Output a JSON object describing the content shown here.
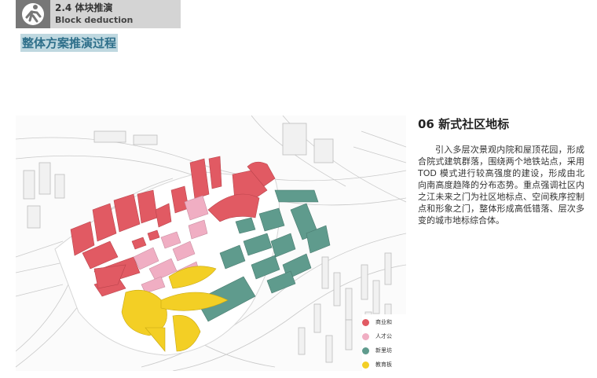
{
  "header": {
    "title": "2.4 体块推演",
    "subtitle": "Block deduction"
  },
  "page_title": "整体方案推演过程",
  "section": {
    "title": "06 新式社区地标",
    "body": "引入多层次景观内院和屋顶花园，形成合院式建筑群落，围绕两个地铁站点，采用 TOD 模式进行较高强度的建设，形成由北向南高度趋降的分布态势。重点强调社区内之江未来之门为社区地标点、空间秩序控制点和形象之门，整体形成高低错落、层次多变的城市地标综合体。"
  },
  "legend": [
    {
      "label": "商业和",
      "color": "#e15a63"
    },
    {
      "label": "人才公",
      "color": "#f0aec3"
    },
    {
      "label": "新里坊",
      "color": "#5f9b8d"
    },
    {
      "label": "教育板",
      "color": "#f3cf25"
    }
  ],
  "colors": {
    "commercial": "#e15a63",
    "talent_housing": "#f0aec3",
    "neighborhood": "#5f9b8d",
    "education": "#f3cf25"
  },
  "icons": {
    "logo": "runner-figure-icon"
  }
}
